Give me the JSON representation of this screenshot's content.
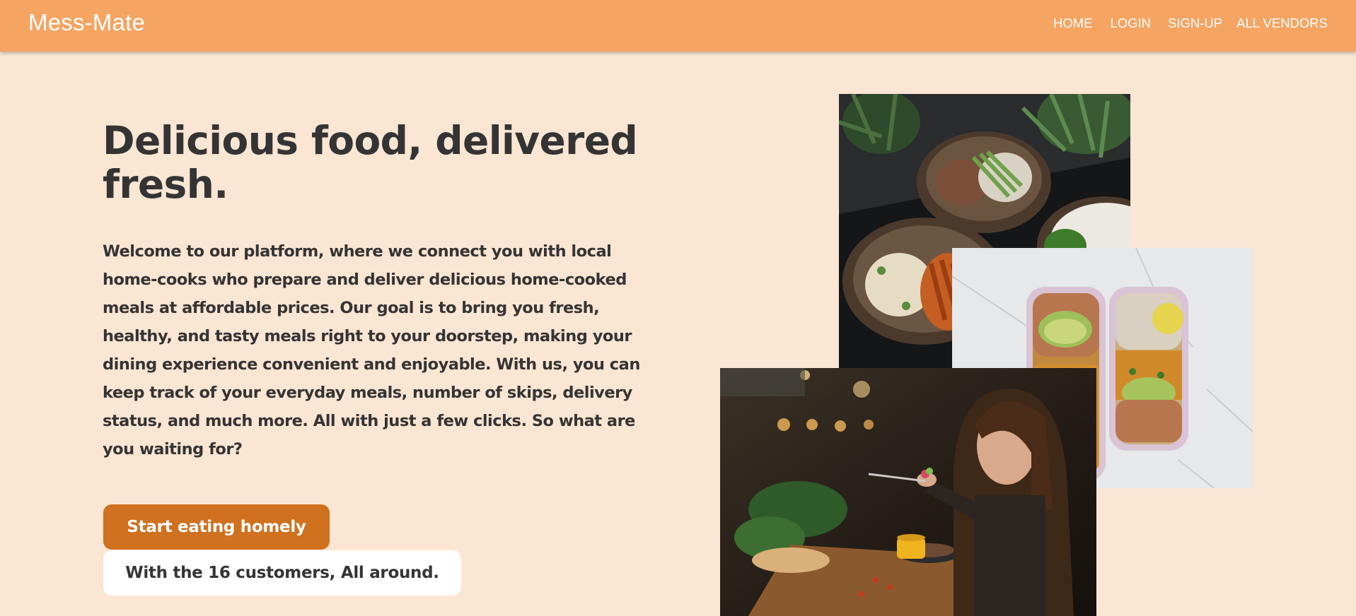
{
  "navbar": {
    "brand": "Mess-Mate",
    "links": [
      "HOME",
      "LOGIN",
      "SIGN-UP",
      "ALL VENDORS"
    ]
  },
  "hero": {
    "title": "Delicious food, delivered fresh.",
    "description": "Welcome to our platform, where we connect you with local home-cooks who prepare and deliver delicious home-cooked meals at affordable prices. Our goal is to bring you fresh, healthy, and tasty meals right to your doorstep, making your dining experience convenient and enjoyable. With us, you can keep track of your everyday meals, number of skips, delivery status, and much more. All with just a few clicks. So what are you waiting for?",
    "cta_label": "Start eating homely",
    "customers_text": "With the 16 customers, All around."
  },
  "images": [
    {
      "name": "food-bowls-photo"
    },
    {
      "name": "meal-prep-boxes-photo"
    },
    {
      "name": "woman-eating-photo"
    }
  ],
  "colors": {
    "navbar": "#f5a462",
    "background": "#fbe5d3",
    "button": "#cf711f",
    "text": "#343434"
  }
}
